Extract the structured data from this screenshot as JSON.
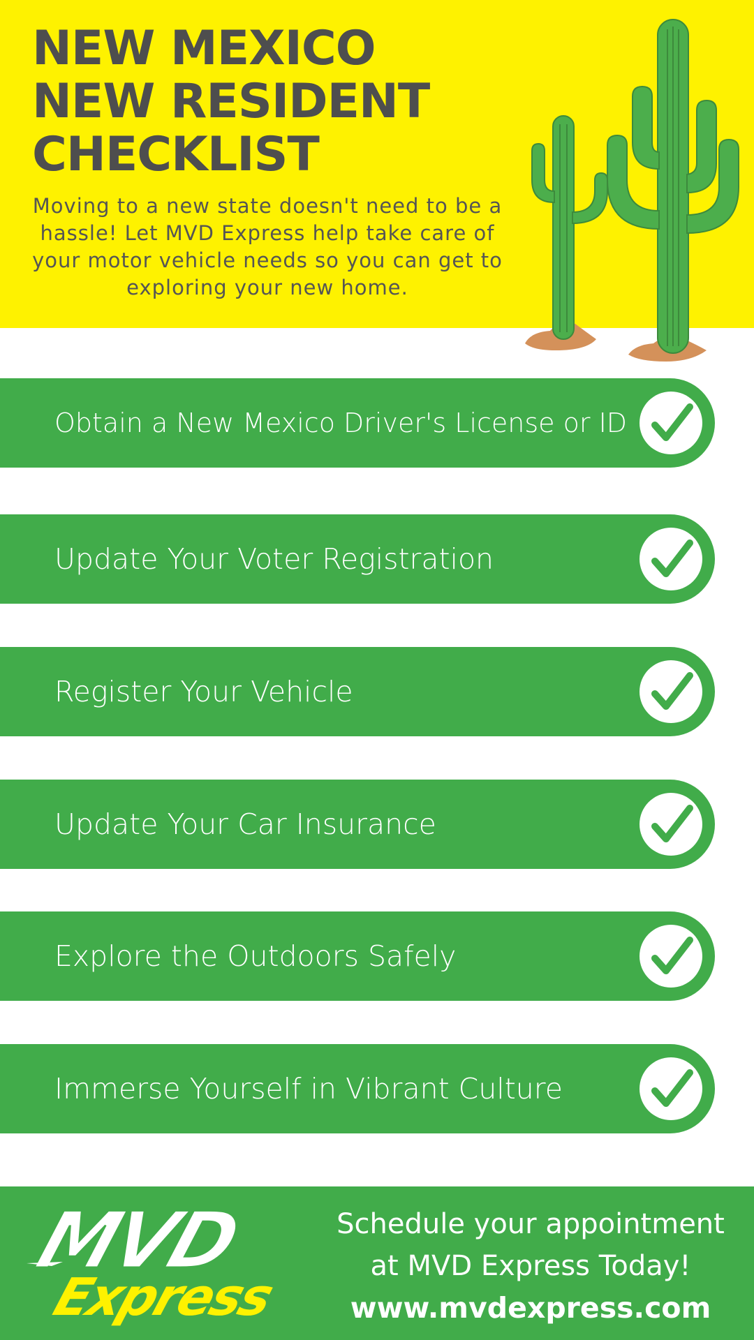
{
  "header": {
    "title_lines": [
      "NEW MEXICO",
      "NEW RESIDENT",
      "CHECKLIST"
    ],
    "intro": "Moving to a new state doesn't need to be a hassle! Let MVD Express help take care of your motor vehicle needs so you can get to exploring your new home."
  },
  "checklist": [
    {
      "label": "Obtain a New Mexico Driver's License or ID",
      "icon": "checkmark-icon"
    },
    {
      "label": "Update Your Voter Registration",
      "icon": "checkmark-icon"
    },
    {
      "label": "Register Your Vehicle",
      "icon": "checkmark-icon"
    },
    {
      "label": "Update Your Car Insurance",
      "icon": "checkmark-icon"
    },
    {
      "label": "Explore the Outdoors Safely",
      "icon": "checkmark-icon"
    },
    {
      "label": "Immerse Yourself in Vibrant Culture",
      "icon": "checkmark-icon"
    }
  ],
  "footer": {
    "logo": {
      "top": "MVD",
      "bottom": "Express"
    },
    "cta_line1": "Schedule your appointment",
    "cta_line2": "at MVD Express Today!",
    "url": "www.mvdexpress.com"
  },
  "colors": {
    "yellow": "#fef200",
    "green": "#41ac4a",
    "title_gray": "#4e4e4e",
    "cactus_green": "#4cae4c",
    "sand": "#d4915a",
    "white": "#ffffff"
  }
}
